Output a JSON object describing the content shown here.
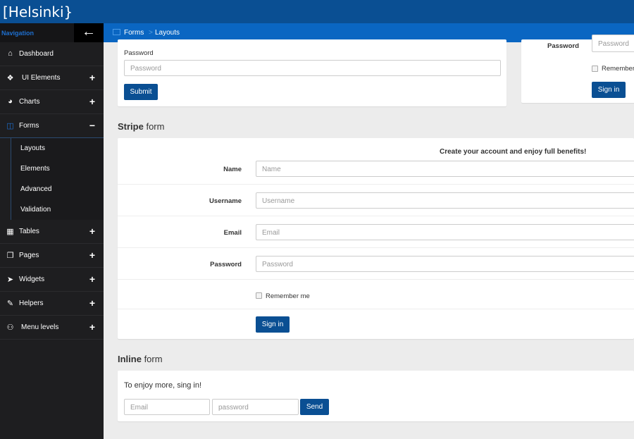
{
  "brand": "[Helsinki}",
  "sidebar": {
    "nav_label": "Navigation",
    "back_icon": "arrow-left-icon",
    "items": [
      {
        "label": "Dashboard",
        "icon": "home-icon"
      },
      {
        "label": "UI Elements",
        "icon": "cubes-icon",
        "toggle": "+"
      },
      {
        "label": "Charts",
        "icon": "pie-chart-icon",
        "toggle": "+"
      },
      {
        "label": "Forms",
        "icon": "columns-icon",
        "toggle": "−"
      }
    ],
    "subitems": [
      "Layouts",
      "Elements",
      "Advanced",
      "Validation"
    ],
    "items2": [
      {
        "label": "Tables",
        "icon": "table-icon",
        "toggle": "+"
      },
      {
        "label": "Pages",
        "icon": "copy-icon",
        "toggle": "+"
      },
      {
        "label": "Widgets",
        "icon": "paper-plane-icon",
        "toggle": "+"
      },
      {
        "label": "Helpers",
        "icon": "magic-wand-icon",
        "toggle": "+"
      },
      {
        "label": "Menu levels",
        "icon": "sitemap-icon",
        "toggle": "+"
      }
    ]
  },
  "breadcrumb": {
    "first": "Forms",
    "separator": ">",
    "second": "Layouts"
  },
  "top_form": {
    "password_label": "Password",
    "password_placeholder": "Password",
    "submit": "Submit"
  },
  "right_form": {
    "password_label": "Password",
    "password_placeholder": "Password",
    "remember": "Remember",
    "sign_in": "Sign in"
  },
  "stripe": {
    "title_bold": "Stripe",
    "title_rest": " form",
    "heading": "Create your account and enjoy full benefits!",
    "fields": [
      {
        "label": "Name",
        "placeholder": "Name"
      },
      {
        "label": "Username",
        "placeholder": "Username"
      },
      {
        "label": "Email",
        "placeholder": "Email"
      },
      {
        "label": "Password",
        "placeholder": "Password"
      }
    ],
    "remember": "Remember me",
    "sign_in": "Sign in"
  },
  "inline": {
    "title_bold": "Inline",
    "title_rest": " form",
    "text": "To enjoy more, sing in!",
    "email_placeholder": "Email",
    "password_placeholder": "password",
    "send": "Send"
  }
}
